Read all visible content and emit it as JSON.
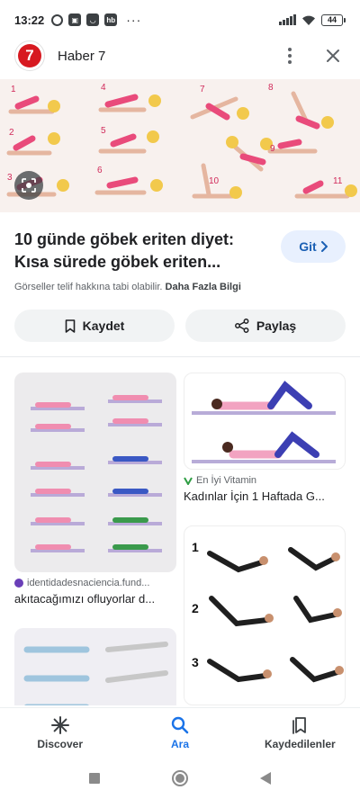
{
  "status_bar": {
    "time": "13:22",
    "icons": [
      "alarm-icon",
      "app-icon",
      "app-icon",
      "hb-icon"
    ],
    "hb": "hb",
    "more": "···",
    "battery": "44"
  },
  "header": {
    "source_logo": "7",
    "source_name": "Haber 7"
  },
  "hero": {
    "step_numbers": [
      "1",
      "2",
      "3",
      "4",
      "5",
      "6",
      "7",
      "8",
      "9",
      "10",
      "11"
    ]
  },
  "result": {
    "title": "10 günde göbek eriten diyet: Kısa sürede göbek eriten...",
    "visit_label": "Git",
    "copyright_text": "Görseller telif hakkına tabi olabilir.",
    "more_info_label": "Daha Fazla Bilgi",
    "save_label": "Kaydet",
    "share_label": "Paylaş"
  },
  "related": [
    {
      "source": "identidadesnaciencia.fund...",
      "title": "akıtacağımızı ofluyorlar d..."
    },
    {
      "source": "En İyi Vitamin",
      "title": "Kadınlar İçin 1 Haftada G..."
    },
    {
      "source": "",
      "title": ""
    },
    {
      "source": "",
      "title": "",
      "numbers": [
        "1",
        "2",
        "3"
      ]
    }
  ],
  "bottom_nav": [
    {
      "label": "Discover",
      "icon": "discover-icon",
      "active": false
    },
    {
      "label": "Ara",
      "icon": "search-icon",
      "active": true
    },
    {
      "label": "Kaydedilenler",
      "icon": "saved-icon",
      "active": false
    }
  ],
  "colors": {
    "accent": "#1a73e8",
    "visit_bg": "#e8f0fe",
    "brand_red": "#d71920"
  }
}
